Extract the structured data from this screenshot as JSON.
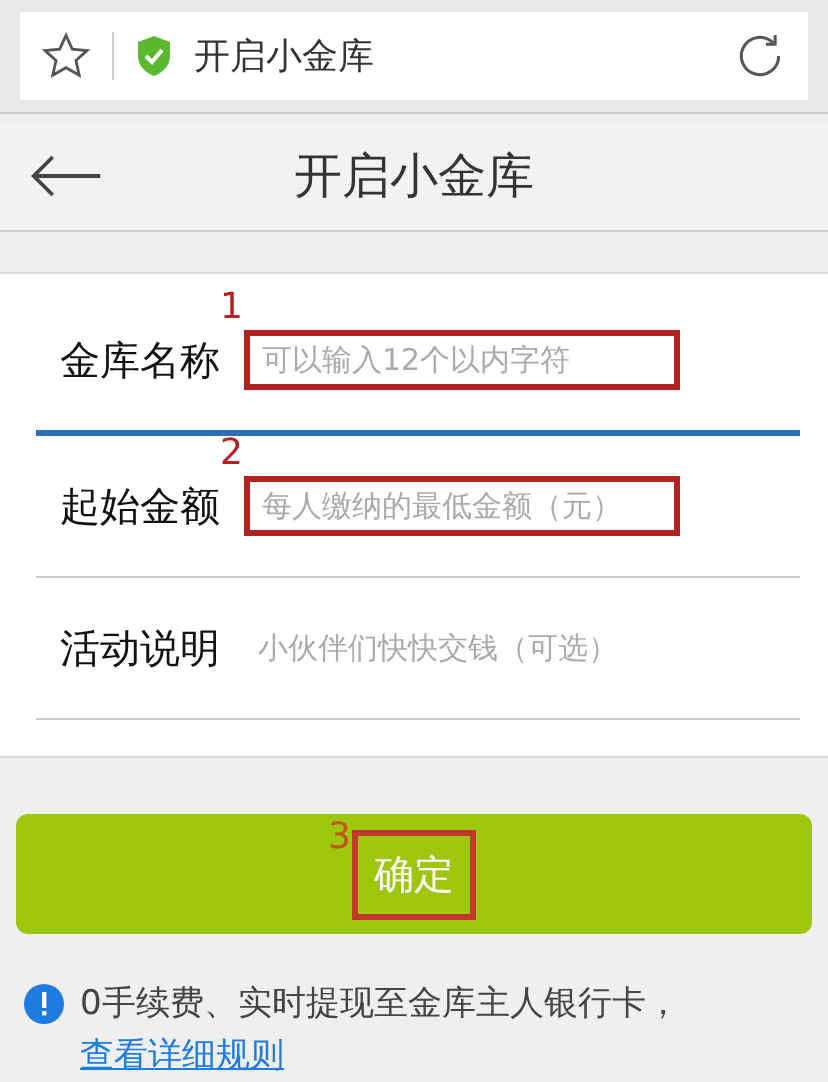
{
  "address_bar": {
    "title": "开启小金库",
    "secure": true
  },
  "header": {
    "title": "开启小金库"
  },
  "fields": [
    {
      "label": "金库名称",
      "placeholder": "可以输入12个以内字符",
      "focused": true,
      "annotation": "1"
    },
    {
      "label": "起始金额",
      "placeholder": "每人缴纳的最低金额（元）",
      "focused": false,
      "annotation": "2"
    },
    {
      "label": "活动说明",
      "placeholder": "小伙伴们快快交钱（可选）",
      "focused": false
    }
  ],
  "button": {
    "label": "确定",
    "annotation": "3"
  },
  "notice": {
    "text": "0手续费、实时提现至金库主人银行卡，",
    "link": "查看详细规则"
  }
}
